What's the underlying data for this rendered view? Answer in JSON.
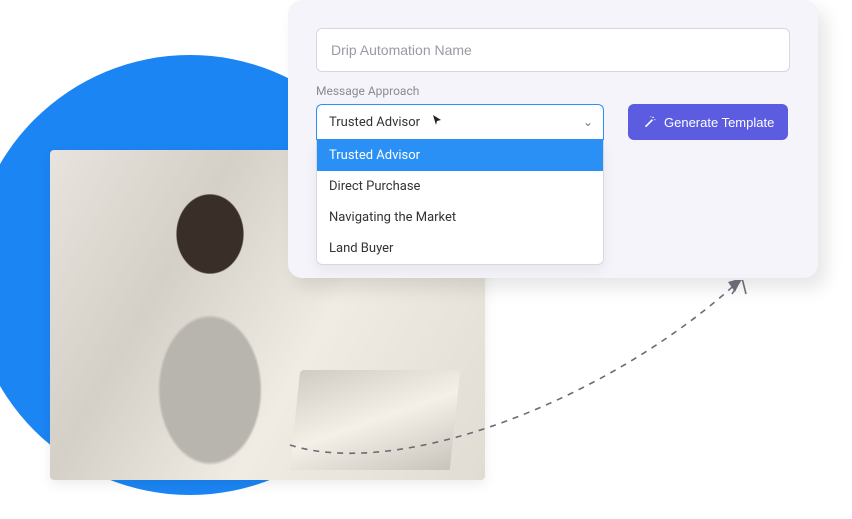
{
  "form": {
    "name_placeholder": "Drip Automation Name",
    "approach_label": "Message Approach",
    "approach_selected": "Trusted Advisor",
    "approach_options": [
      "Trusted Advisor",
      "Direct Purchase",
      "Navigating the Market",
      "Land Buyer"
    ],
    "generate_label": "Generate Template"
  },
  "colors": {
    "accent_blue": "#2b90f5",
    "primary_button": "#5b5ce0",
    "circle": "#1b85f3"
  }
}
